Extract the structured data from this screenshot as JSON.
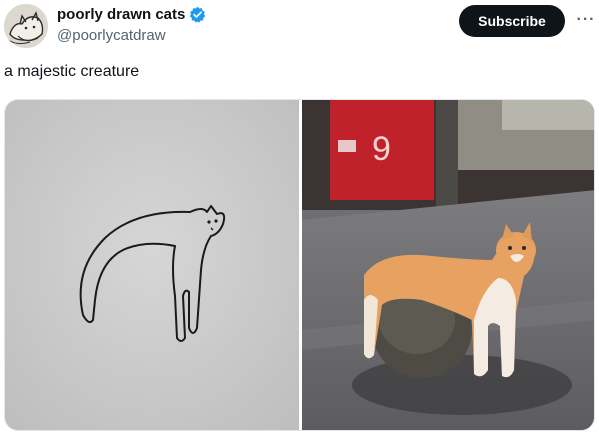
{
  "author": {
    "display_name": "poorly drawn cats",
    "handle": "@poorlycatdraw",
    "verified": true,
    "avatar_icon": "cat-avatar-icon"
  },
  "actions": {
    "subscribe_label": "Subscribe",
    "more_label": "···"
  },
  "tweet": {
    "text": "a majestic creature"
  },
  "media": {
    "left_image": "cat drawing on paper",
    "right_image": "orange cat photo",
    "sign_number": "9"
  },
  "colors": {
    "verified_blue": "#1d9bf0",
    "button_bg": "#0f1419",
    "handle_gray": "#536471"
  }
}
